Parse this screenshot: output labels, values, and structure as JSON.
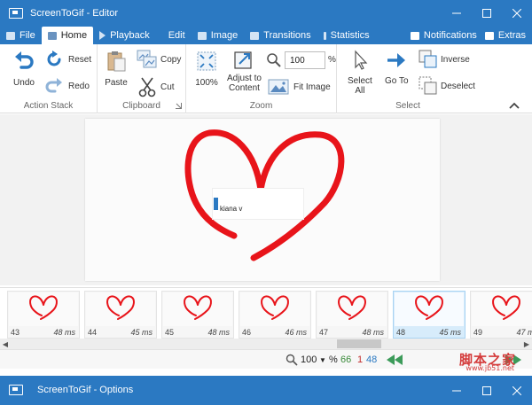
{
  "window": {
    "title": "ScreenToGif - Editor",
    "minimize_icon": "minimize-icon",
    "maximize_icon": "maximize-icon",
    "close_icon": "close-icon"
  },
  "tabs": [
    {
      "label": "File",
      "active": false
    },
    {
      "label": "Home",
      "active": true
    },
    {
      "label": "Playback",
      "active": false
    },
    {
      "label": "Edit",
      "active": false
    },
    {
      "label": "Image",
      "active": false
    },
    {
      "label": "Transitions",
      "active": false
    },
    {
      "label": "Statistics",
      "active": false
    }
  ],
  "tabs_right": {
    "notifications": "Notifications",
    "extras": "Extras"
  },
  "ribbon": {
    "action_stack": {
      "label": "Action Stack",
      "undo": "Undo",
      "reset": "Reset",
      "redo": "Redo"
    },
    "clipboard": {
      "label": "Clipboard",
      "paste": "Paste",
      "copy": "Copy",
      "cut": "Cut"
    },
    "zoom": {
      "label": "Zoom",
      "hundred": "100%",
      "adjust_line1": "Adjust to",
      "adjust_line2": "Content",
      "fit_image": "Fit Image",
      "value": "100",
      "unit": "%"
    },
    "select": {
      "label": "Select",
      "select_all_line1": "Select",
      "select_all_line2": "All",
      "go_to": "Go To",
      "inverse": "Inverse",
      "deselect": "Deselect"
    }
  },
  "canvas": {
    "overlay_text": "kiana v"
  },
  "frames": [
    {
      "number": "43",
      "duration": "48 ms",
      "selected": false
    },
    {
      "number": "44",
      "duration": "45 ms",
      "selected": false
    },
    {
      "number": "45",
      "duration": "48 ms",
      "selected": false
    },
    {
      "number": "46",
      "duration": "46 ms",
      "selected": false
    },
    {
      "number": "47",
      "duration": "48 ms",
      "selected": false
    },
    {
      "number": "48",
      "duration": "45 ms",
      "selected": true
    },
    {
      "number": "49",
      "duration": "47 ms",
      "selected": false
    }
  ],
  "status": {
    "zoom_value": "100",
    "zoom_unit": "%",
    "frame_count": "66",
    "selected_count": "1",
    "current_frame": "48"
  },
  "second_window": {
    "title": "ScreenToGif - Options"
  },
  "watermark": {
    "text": "脚本之家",
    "url": "www.jb51.net"
  },
  "colors": {
    "accent": "#2b79c2",
    "heart": "#e8141a",
    "selected_frame": "#d7ecfb",
    "count_green": "#3c8b3c",
    "count_red": "#c12b2b"
  }
}
